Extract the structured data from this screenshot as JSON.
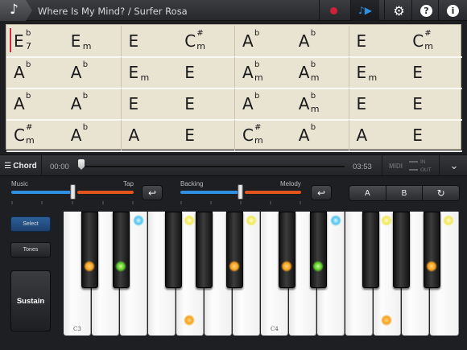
{
  "topbar": {
    "note_icon": "♪",
    "song_title": "Where Is My Mind? / Surfer Rosa",
    "play_icon": "♪▶",
    "gear_icon": "⚙",
    "help_icon": "?",
    "info_icon": "i",
    "record_color": "#d0203a",
    "accent": "#2f8fe0"
  },
  "chords": {
    "rows": [
      [
        {
          "root": "E",
          "acc": "b",
          "qual": "7"
        },
        {
          "root": "E",
          "acc": "",
          "qual": "m"
        },
        {
          "root": "E",
          "acc": "",
          "qual": ""
        },
        {
          "root": "C",
          "acc": "#",
          "qual": "m"
        },
        {
          "root": "A",
          "acc": "b",
          "qual": ""
        },
        {
          "root": "A",
          "acc": "b",
          "qual": ""
        },
        {
          "root": "E",
          "acc": "",
          "qual": ""
        },
        {
          "root": "C",
          "acc": "#",
          "qual": "m"
        }
      ],
      [
        {
          "root": "A",
          "acc": "b",
          "qual": ""
        },
        {
          "root": "A",
          "acc": "b",
          "qual": ""
        },
        {
          "root": "E",
          "acc": "",
          "qual": "m"
        },
        {
          "root": "E",
          "acc": "",
          "qual": ""
        },
        {
          "root": "A",
          "acc": "b",
          "qual": "m"
        },
        {
          "root": "A",
          "acc": "b",
          "qual": "m"
        },
        {
          "root": "E",
          "acc": "",
          "qual": "m"
        },
        {
          "root": "E",
          "acc": "",
          "qual": ""
        }
      ],
      [
        {
          "root": "A",
          "acc": "b",
          "qual": ""
        },
        {
          "root": "A",
          "acc": "b",
          "qual": ""
        },
        {
          "root": "E",
          "acc": "",
          "qual": ""
        },
        {
          "root": "E",
          "acc": "",
          "qual": ""
        },
        {
          "root": "A",
          "acc": "b",
          "qual": ""
        },
        {
          "root": "A",
          "acc": "b",
          "qual": "m"
        },
        {
          "root": "E",
          "acc": "",
          "qual": ""
        },
        {
          "root": "E",
          "acc": "",
          "qual": ""
        }
      ],
      [
        {
          "root": "C",
          "acc": "#",
          "qual": "m"
        },
        {
          "root": "A",
          "acc": "b",
          "qual": ""
        },
        {
          "root": "A",
          "acc": "",
          "qual": ""
        },
        {
          "root": "E",
          "acc": "",
          "qual": ""
        },
        {
          "root": "C",
          "acc": "#",
          "qual": "m"
        },
        {
          "root": "A",
          "acc": "b",
          "qual": ""
        },
        {
          "root": "A",
          "acc": "",
          "qual": ""
        },
        {
          "root": "E",
          "acc": "",
          "qual": ""
        }
      ]
    ]
  },
  "transport": {
    "chord_label": "Chord",
    "chord_icon": "☰",
    "current_time": "00:00",
    "total_time": "03:53",
    "progress": 0.0,
    "midi_label": "MIDI",
    "midi_in": "IN",
    "midi_out": "OUT",
    "collapse_icon": "⌄"
  },
  "mixer": {
    "music_label": "Music",
    "tap_label": "Tap",
    "music_tap_level": 0.5,
    "backing_label": "Backing",
    "melody_label": "Melody",
    "backing_melody_level": 0.5,
    "return_icon": "↩",
    "section_a": "A",
    "section_b": "B",
    "loop_icon": "↻"
  },
  "side": {
    "select_label": "Select",
    "tones_label": "Tones",
    "sustain_label": "Sustain"
  },
  "keyboard": {
    "label_c3": "C3",
    "label_c4": "C4"
  }
}
